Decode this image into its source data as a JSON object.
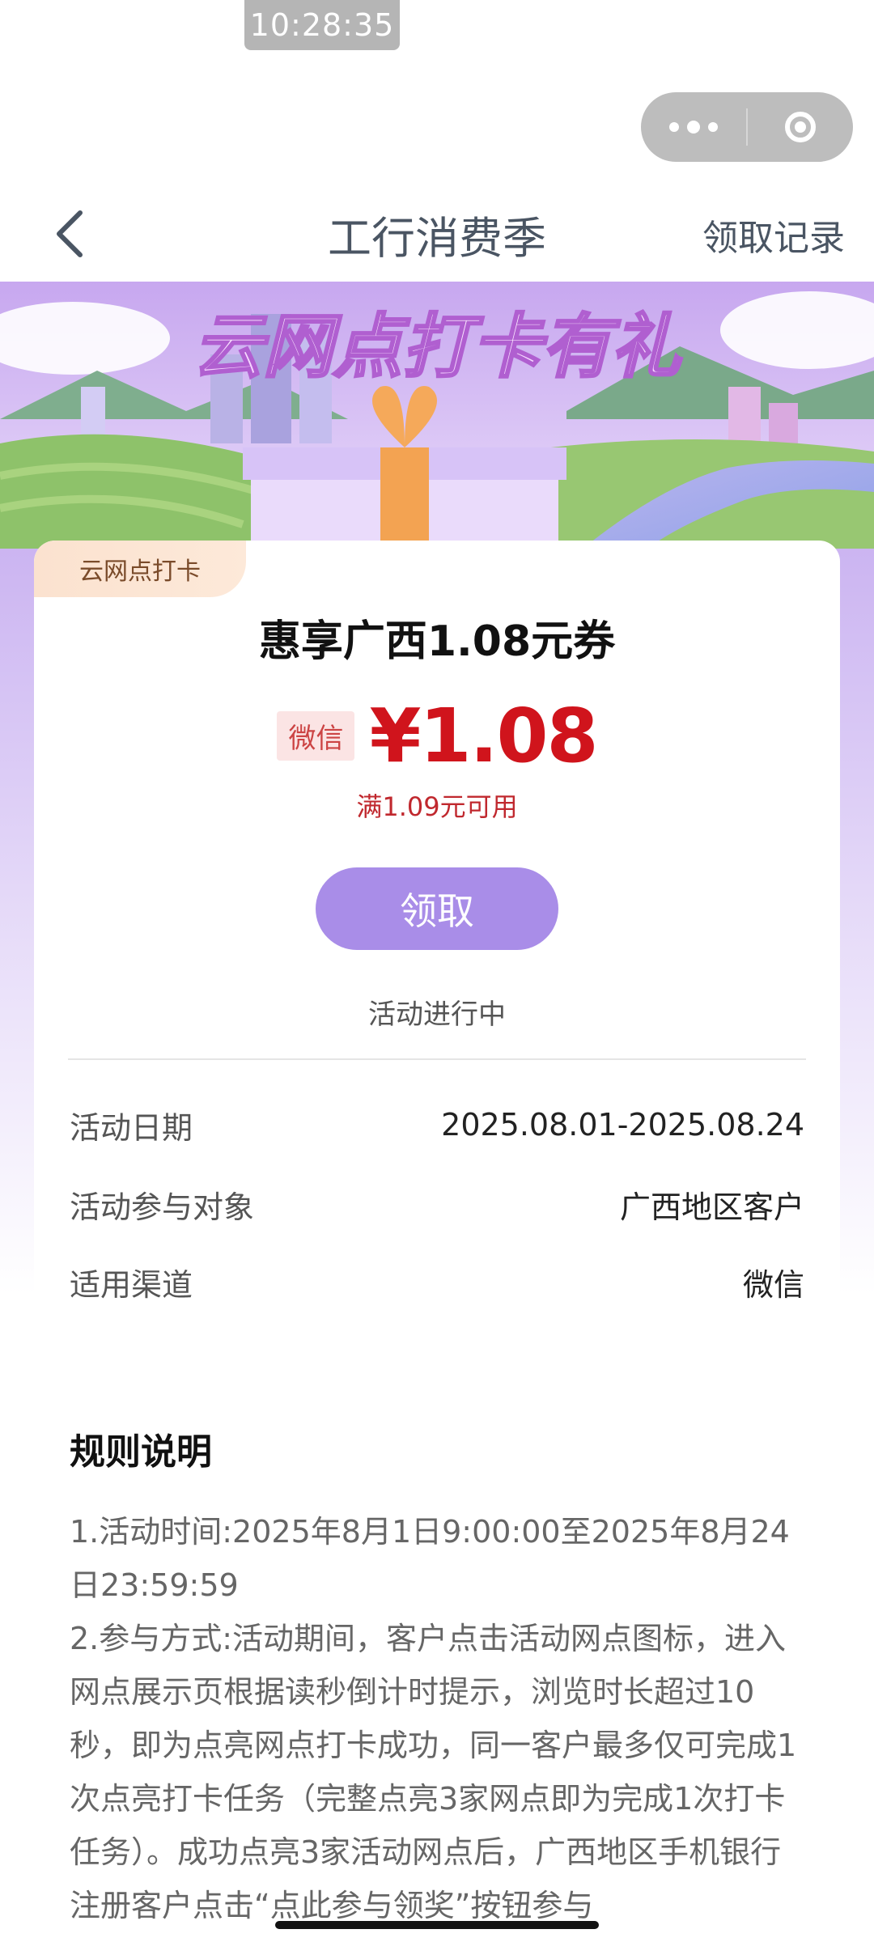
{
  "status": {
    "time": "10:28:35"
  },
  "nav": {
    "title": "工行消费季",
    "right_link": "领取记录"
  },
  "banner": {
    "headline": "云网点打卡有礼"
  },
  "coupon": {
    "tag": "云网点打卡",
    "title": "惠享广西1.08元券",
    "channel_badge": "微信",
    "price": "¥1.08",
    "condition": "满1.09元可用",
    "claim_button": "领取",
    "status": "活动进行中"
  },
  "info": [
    {
      "label": "活动日期",
      "value": "2025.08.01-2025.08.24"
    },
    {
      "label": "活动参与对象",
      "value": "广西地区客户"
    },
    {
      "label": "适用渠道",
      "value": "微信"
    }
  ],
  "rules": {
    "title": "规则说明",
    "p1": "1.活动时间:2025年8月1日9:00:00至2025年8月24日23:59:59",
    "p2": "2.参与方式:活动期间，客户点击活动网点图标，进入网点展示页根据读秒倒计时提示，浏览时长超过10秒，即为点亮网点打卡成功，同一客户最多仅可完成1次点亮打卡任务（完整点亮3家网点即为完成1次打卡任务）。成功点亮3家活动网点后，广西地区手机银行注册客户点击“点此参与领奖”按钮参与"
  },
  "colors": {
    "accent": "#a98de8",
    "price": "#d0141c",
    "nav_text": "#4a5563"
  }
}
